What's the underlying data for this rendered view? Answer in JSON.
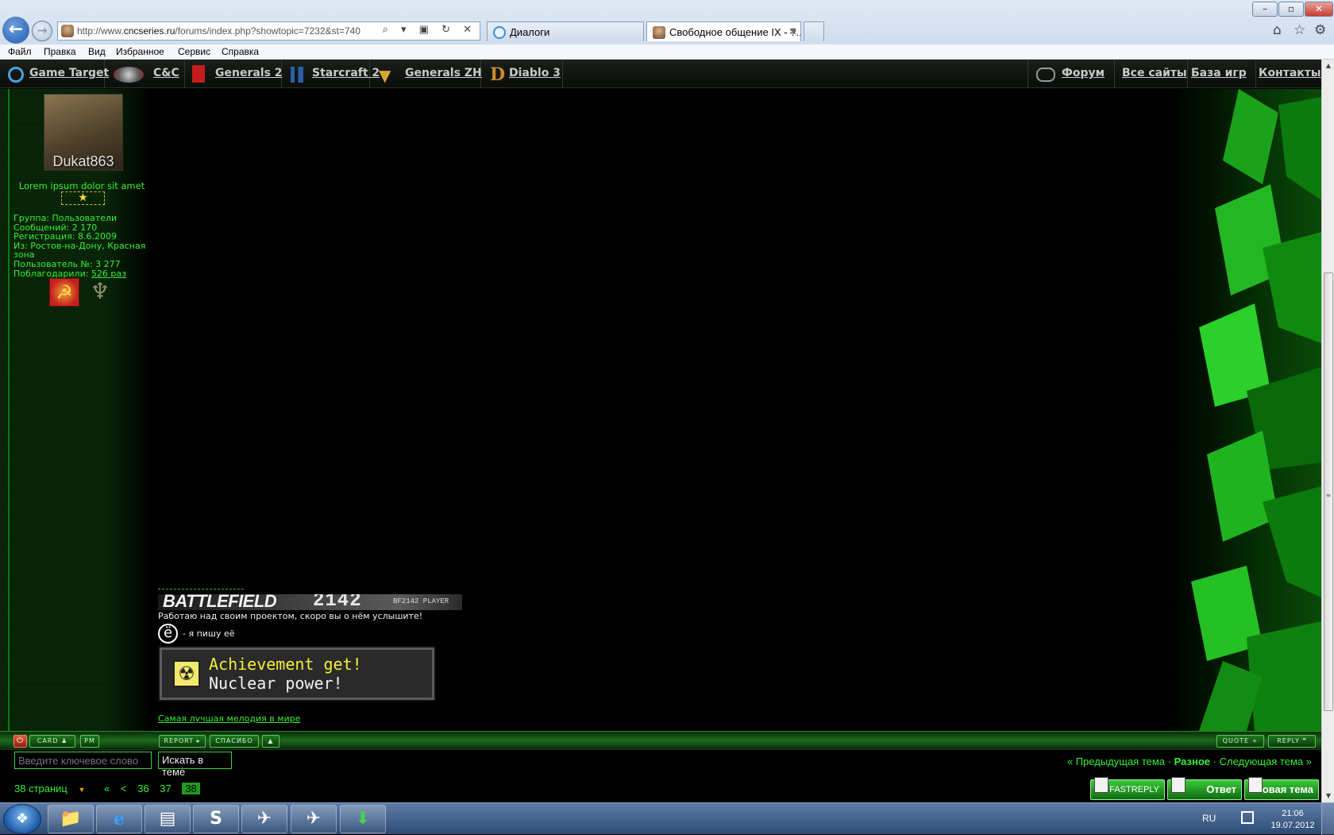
{
  "browser": {
    "url_prefix": "http://www.",
    "url_host": "cncseries.ru",
    "url_path": "/forums/index.php?showtopic=7232&st=740",
    "address_controls": "⌕ ▾ ▣ ↻ ✕",
    "tabs": [
      {
        "label": "Диалоги",
        "active": false
      },
      {
        "label": "Свободное общение IX - ?...",
        "active": true
      }
    ],
    "tab_close": "✕",
    "menu": [
      "Файл",
      "Правка",
      "Вид",
      "Избранное",
      "Сервис",
      "Справка"
    ],
    "window_controls": {
      "minimize": "–",
      "maximize": "▫",
      "close": "✕"
    },
    "toolbar_icons": {
      "home": "⌂",
      "favorites": "☆",
      "settings": "⚙"
    },
    "back_glyph": "←",
    "forward_glyph": "→"
  },
  "site_nav": {
    "left": [
      {
        "label": "Game Target",
        "icon": "game-target-icon"
      },
      {
        "label": "C&C",
        "icon": "cnc-icon"
      },
      {
        "label": "Generals 2",
        "icon": "generals2-icon"
      },
      {
        "label": "Starcraft 2",
        "icon": "starcraft2-icon"
      },
      {
        "label": "Generals ZH",
        "icon": "generals-zh-icon"
      },
      {
        "label": "Diablo 3",
        "icon": "diablo3-icon"
      }
    ],
    "right": [
      {
        "label": "Форум",
        "icon": "forum-icon"
      },
      {
        "label": "Все сайты"
      },
      {
        "label": "База игр"
      },
      {
        "label": "Контакты"
      }
    ]
  },
  "post": {
    "author": {
      "avatar_name": "Dukat863",
      "title": "Lorem ipsum dolor sit amet",
      "star": "★",
      "group": "Группа: Пользователи",
      "posts": "Сообщений: 2 170",
      "registered": "Регистрация: 8.6.2009",
      "from": "Из: Ростов-на-Дону, Красная зона",
      "user_no": "Пользователь №: 3 277",
      "thanked_prefix": "Поблагодарили:",
      "thanked_link": "526 раз",
      "badge1_glyph": "☭",
      "badge2_glyph": "♆"
    },
    "signature": {
      "banner_title": "BATTLEFIELD",
      "banner_number": "2142",
      "banner_sub": "BF2142 PLAYER",
      "text1": "Работаю над своим проектом, скоро вы о нём услышите!",
      "yo_glyph": "ё",
      "text2": "- я пишу её",
      "achievement_title": "Achievement get!",
      "achievement_desc": "Nuclear power!",
      "achievement_icon": "☢",
      "link": "Самая лучшая мелодия в мире"
    },
    "actions_left": {
      "power": "⏻",
      "card": "CARD",
      "card_icon": "♟",
      "pm": "PM"
    },
    "actions_mid": {
      "report": "REPORT ▸",
      "thanks": "СПАСИБО",
      "up": "▲"
    },
    "actions_right": {
      "quote": "QUOTE +",
      "reply": "REPLY ❞"
    }
  },
  "search": {
    "keyword_placeholder": "Введите ключевое слово",
    "button": "Искать в теме"
  },
  "topic_nav": {
    "prev": "« Предыдущая тема",
    "sep": "·",
    "current": "Разное",
    "next": "Следующая тема »"
  },
  "pager": {
    "total": "38 страниц",
    "dropdown": "▼",
    "first": "«",
    "prev": "<",
    "pages": [
      "36",
      "37"
    ],
    "current": "38"
  },
  "bottom_buttons": {
    "fastreply": "FASTREPLY",
    "reply": "Ответ",
    "new_topic": "Новая тема"
  },
  "taskbar": {
    "start_glyph": "❖",
    "apps": [
      {
        "name": "explorer",
        "glyph": "📁"
      },
      {
        "name": "internet-explorer",
        "glyph": "e"
      },
      {
        "name": "notes",
        "glyph": "▤"
      },
      {
        "name": "skype",
        "glyph": "S"
      },
      {
        "name": "game1",
        "glyph": "✈"
      },
      {
        "name": "game2",
        "glyph": "✈"
      },
      {
        "name": "downloader",
        "glyph": "⬇"
      }
    ],
    "lang": "RU",
    "time": "21:06",
    "date": "19.07.2012"
  },
  "colors": {
    "forum_green": "#35f035",
    "background": "#000000"
  }
}
